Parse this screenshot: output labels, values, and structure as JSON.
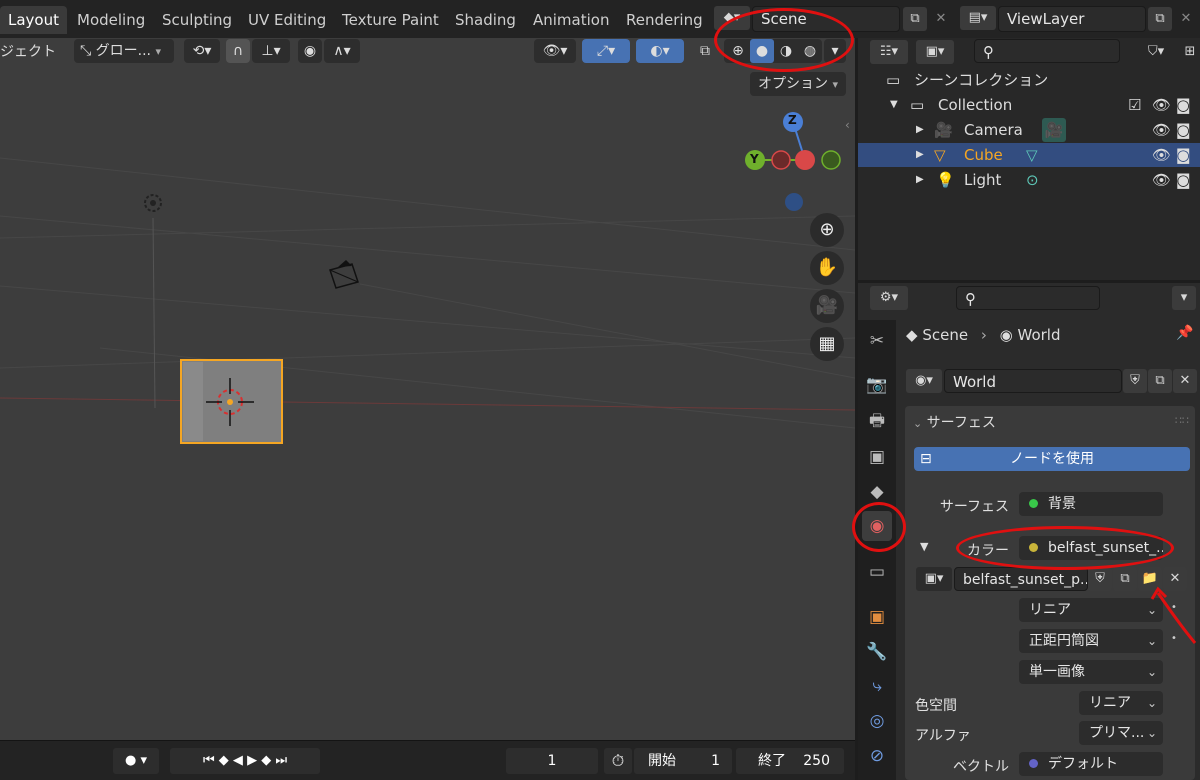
{
  "workspace_tabs": [
    "Layout",
    "Modeling",
    "Sculpting",
    "UV Editing",
    "Texture Paint",
    "Shading",
    "Animation",
    "Rendering"
  ],
  "scene": {
    "name": "Scene"
  },
  "viewlayer": {
    "name": "ViewLayer"
  },
  "viewport": {
    "mode_label": "ジェクト",
    "transform_orientation": "グロー...",
    "options_label": "オプション",
    "gizmo": {
      "z": "Z",
      "y": "Y"
    }
  },
  "timeline": {
    "current_frame": "1",
    "start_label": "開始",
    "start_value": "1",
    "end_label": "終了",
    "end_value": "250"
  },
  "outliner": {
    "scene_collection": "シーンコレクション",
    "items": [
      {
        "label": "Collection"
      },
      {
        "label": "Camera"
      },
      {
        "label": "Cube"
      },
      {
        "label": "Light"
      }
    ]
  },
  "properties": {
    "breadcrumb": {
      "scene": "Scene",
      "world": "World"
    },
    "world_name": "World",
    "panel_title": "サーフェス",
    "use_nodes_label": "ノードを使用",
    "surface_label": "サーフェス",
    "surface_value": "背景",
    "color_label": "カラー",
    "color_value": "belfast_sunset_...",
    "image_name": "belfast_sunset_p...",
    "interpolation": "リニア",
    "projection": "正距円筒図",
    "source": "単一画像",
    "colorspace_label": "色空間",
    "colorspace_value": "リニア",
    "alpha_label": "アルファ",
    "alpha_value": "プリマ...",
    "vector_label": "ベクトル",
    "vector_value": "デフォルト"
  },
  "colors": {
    "accent_blue": "#4772b3",
    "selection_orange": "#f5a623",
    "annotation_red": "#e01010",
    "outliner_selected": "#334d80"
  }
}
